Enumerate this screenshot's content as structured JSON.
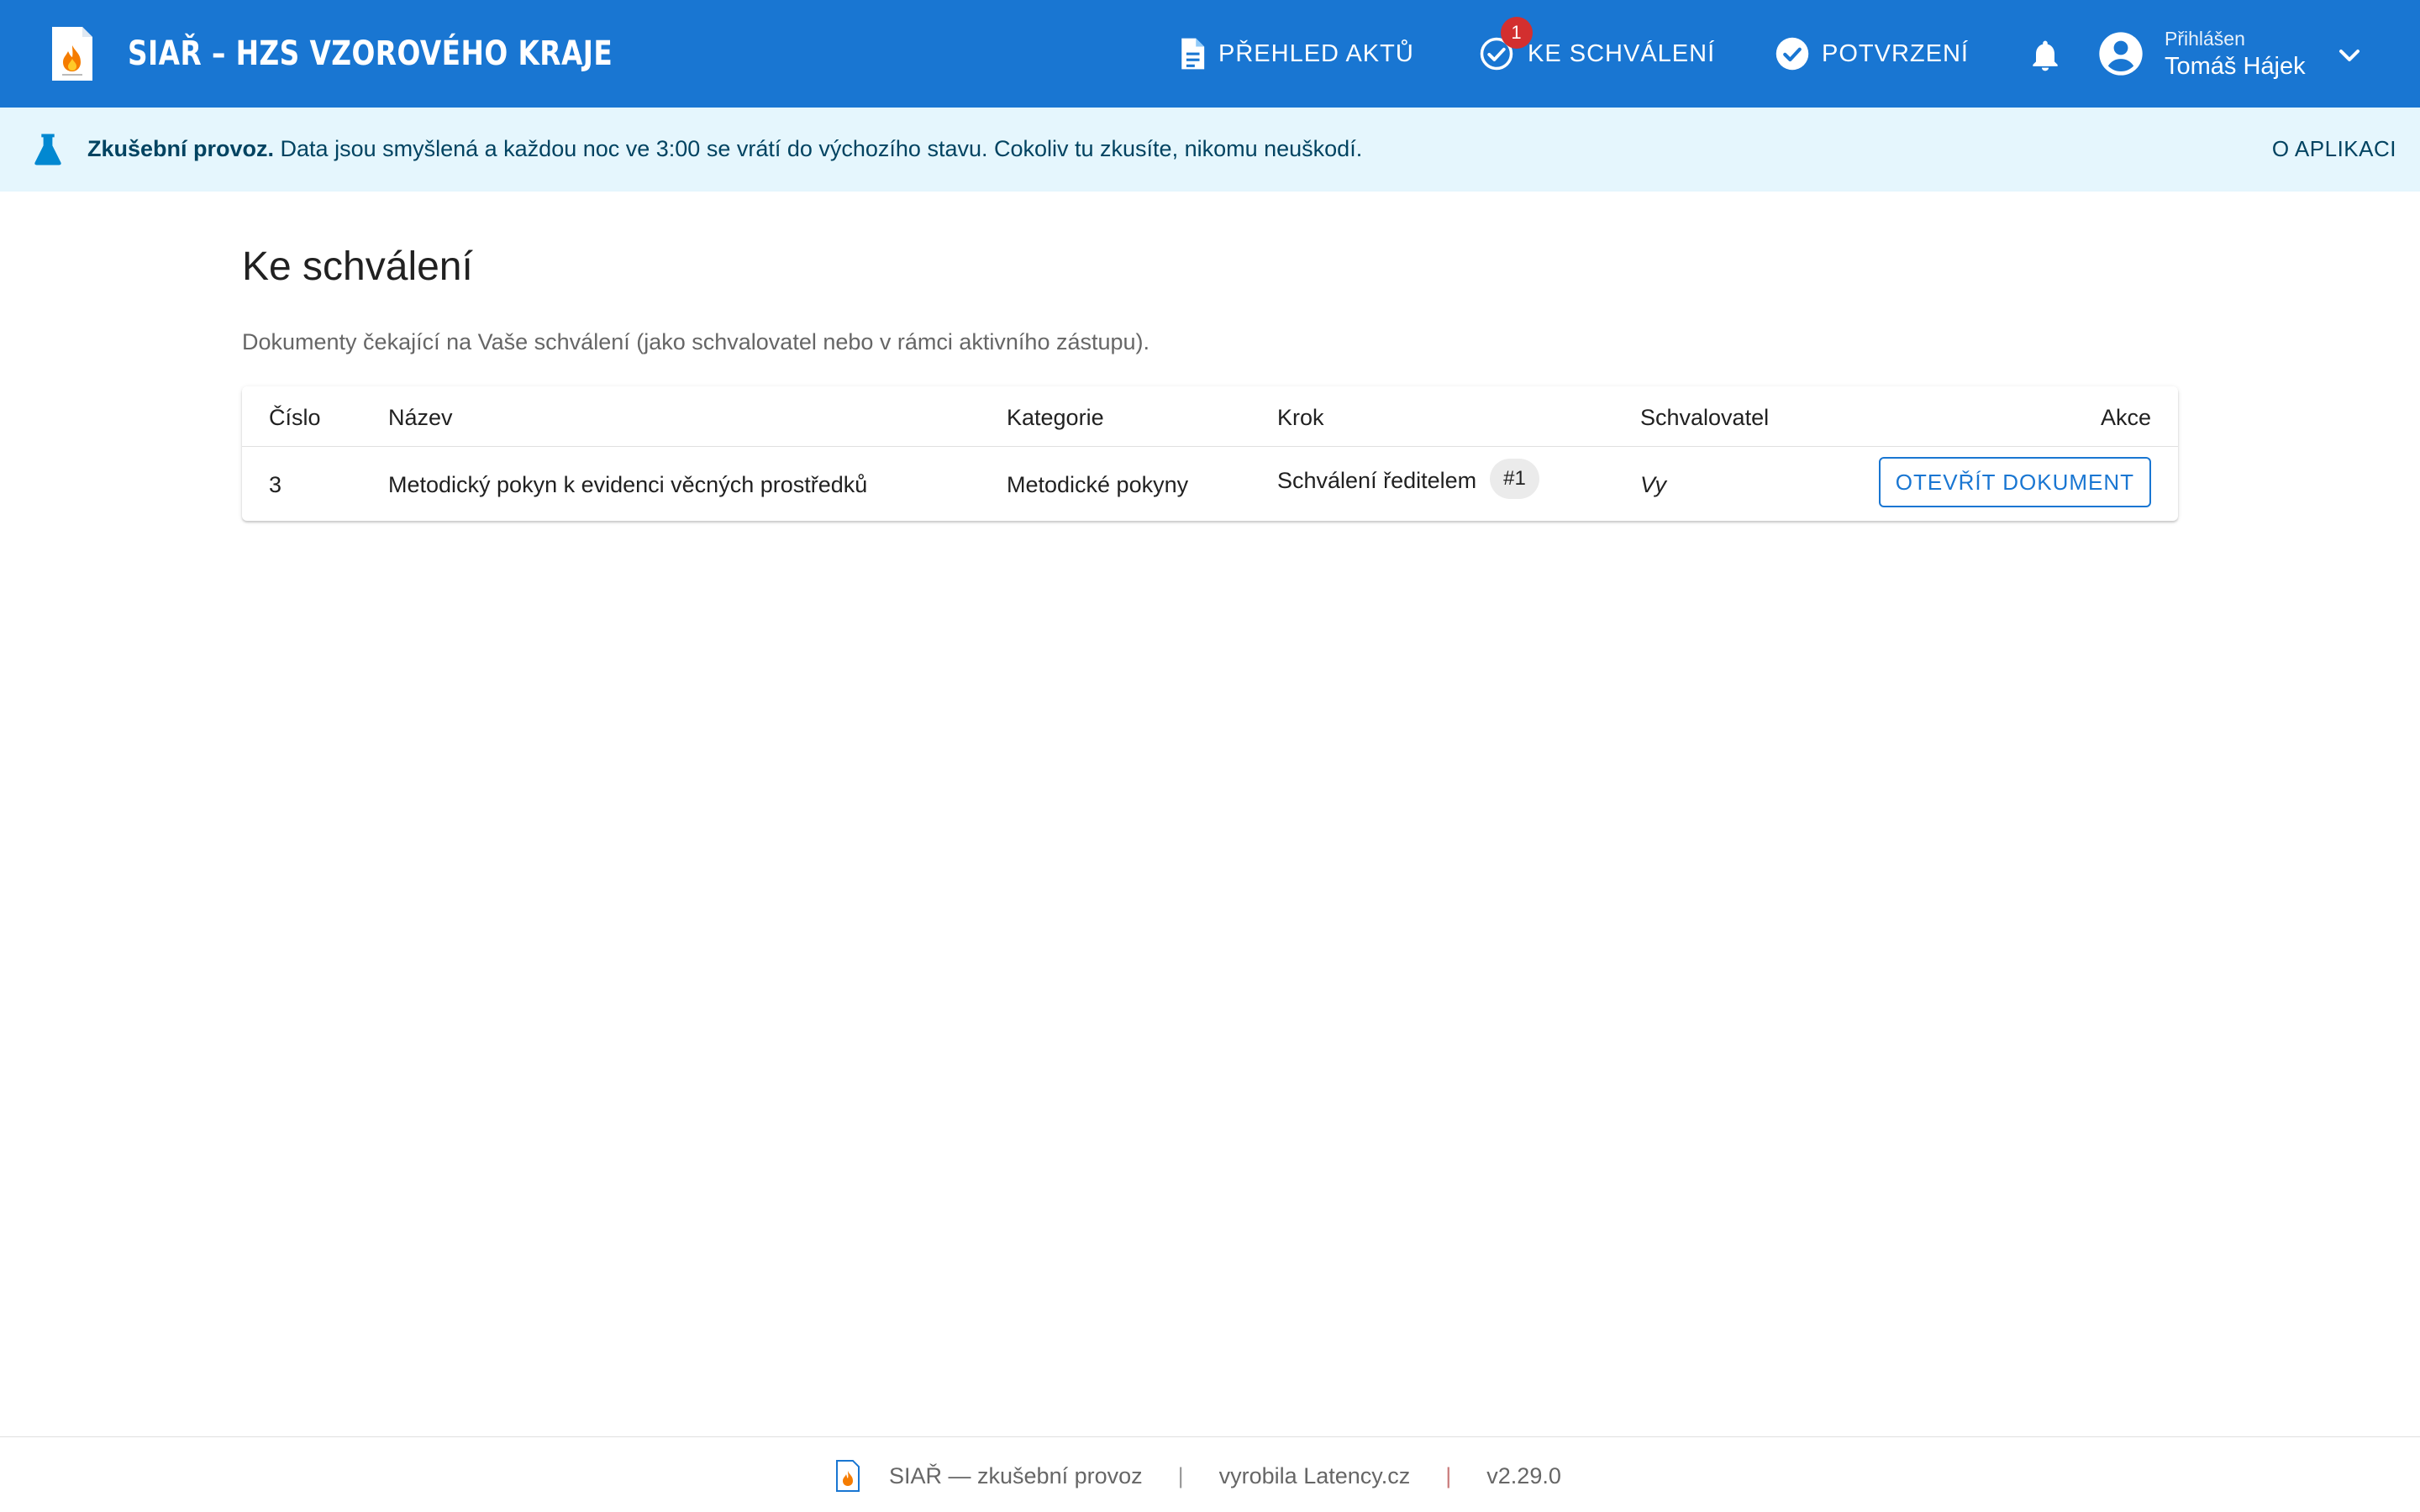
{
  "app": {
    "brand": "SIAŘ – HZS VZOROVÉHO KRAJE"
  },
  "nav": {
    "overview_label": "PŘEHLED AKTŮ",
    "approve_label": "KE SCHVÁLENÍ",
    "approve_badge": "1",
    "confirm_label": "POTVRZENÍ"
  },
  "user": {
    "caption": "Přihlášen",
    "name": "Tomáš Hájek"
  },
  "banner": {
    "bold": "Zkušební provoz.",
    "text": " Data jsou smyšlená a každou noc ve 3:00 se vrátí do výchozího stavu. Cokoliv tu zkusíte, nikomu neuškodí.",
    "about": "O APLIKACI"
  },
  "page": {
    "title": "Ke schválení",
    "subtitle": "Dokumenty čekající na Vaše schválení (jako schvalovatel nebo v rámci aktivního zástupu)."
  },
  "table": {
    "headers": {
      "number": "Číslo",
      "name": "Název",
      "category": "Kategorie",
      "step": "Krok",
      "approver": "Schvalovatel",
      "action": "Akce"
    },
    "rows": [
      {
        "number": "3",
        "name": "Metodický pokyn k evidenci věcných prostředků",
        "category": "Metodické pokyny",
        "step": "Schválení ředitelem",
        "step_chip": "#1",
        "approver": "Vy",
        "action": "OTEVŘÍT DOKUMENT"
      }
    ]
  },
  "footer": {
    "product": "SIAŘ — zkušební provoz",
    "separator": "|",
    "author": "vyrobila Latency.cz",
    "version": "v2.29.0"
  },
  "colors": {
    "primary": "#1976d2",
    "banner_bg": "#e5f6fd",
    "badge": "#d32f2f",
    "flame": "#f57c00"
  }
}
